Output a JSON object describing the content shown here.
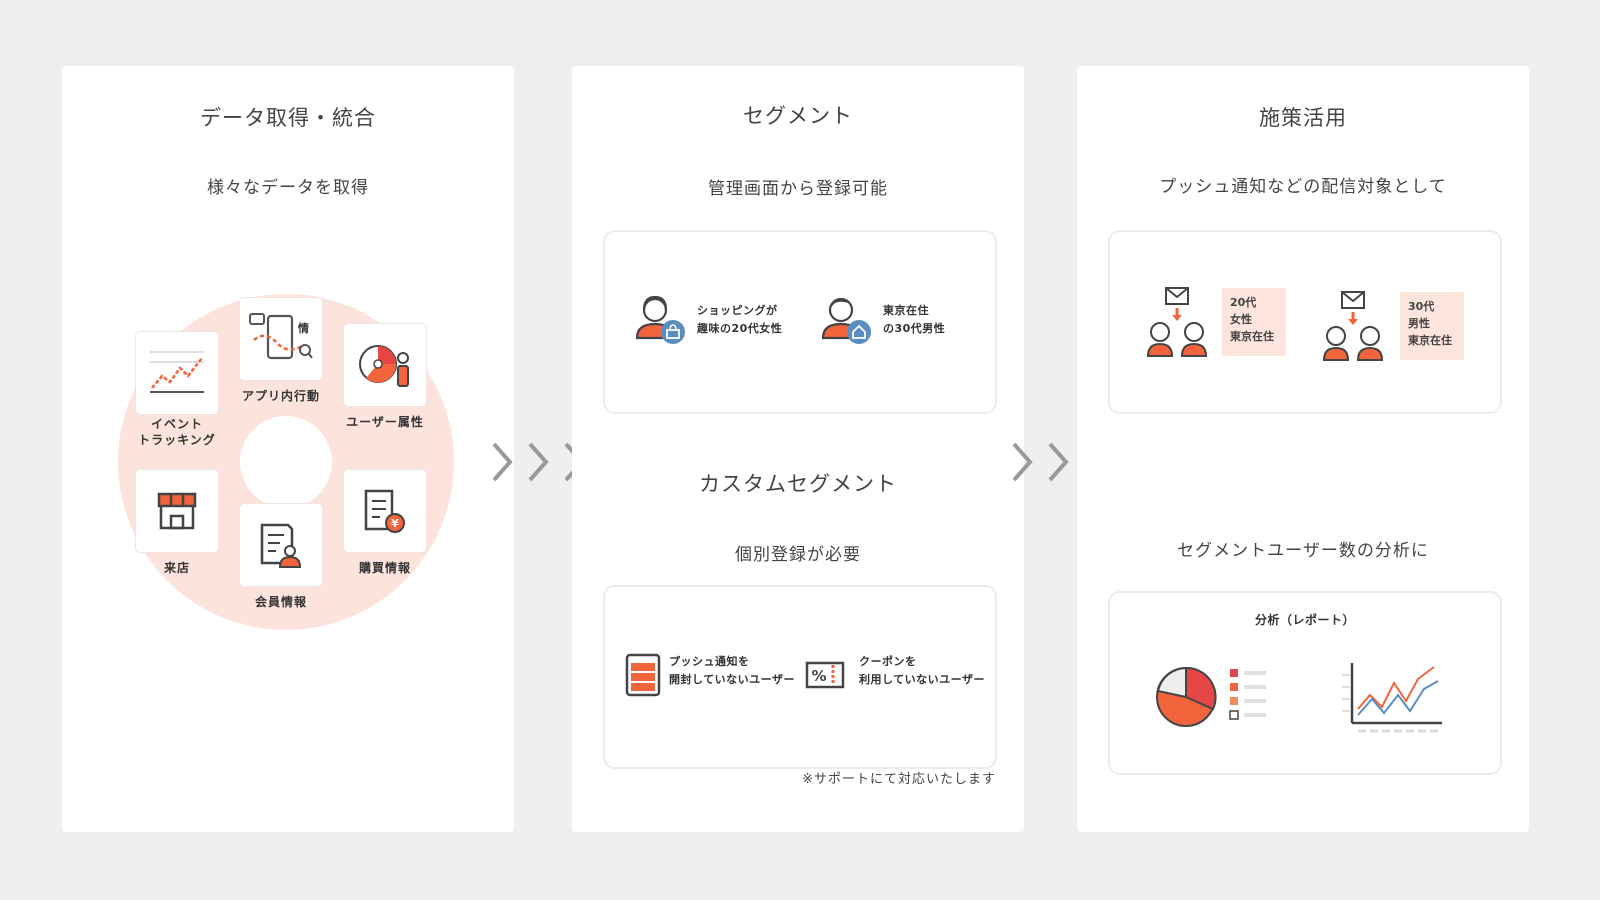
{
  "panels": {
    "acquire": {
      "title": "データ取得・統合",
      "subtitle": "様々なデータを取得",
      "sources": {
        "event": "イベント\nトラッキング",
        "app": "アプリ内行動",
        "attr": "ユーザー属性",
        "store": "来店",
        "member": "会員情報",
        "purchase": "購買情報"
      },
      "app_icon_glyph": "情"
    },
    "segment": {
      "title": "セグメント",
      "subtitle": "管理画面から登録可能",
      "examples": [
        {
          "label": "ショッピングが\n趣味の20代女性",
          "icon": "shopping-bag-icon"
        },
        {
          "label": "東京在住\nの30代男性",
          "icon": "home-icon"
        }
      ],
      "custom_title": "カスタムセグメント",
      "custom_subtitle": "個別登録が必要",
      "custom_examples": [
        {
          "label": "プッシュ通知を\n開封していないユーザー",
          "icon": "phone-list-icon"
        },
        {
          "label": "クーポンを\n利用していないユーザー",
          "icon": "coupon-icon"
        }
      ],
      "custom_coupon_glyph": "%",
      "note": "※サポートにて対応いたします"
    },
    "usage": {
      "title": "施策活用",
      "subtitle": "プッシュ通知などの配信対象として",
      "targets": [
        {
          "tag": "20代\n女性\n東京在住"
        },
        {
          "tag": "30代\n男性\n東京在住"
        }
      ],
      "analysis_subtitle": "セグメントユーザー数の分析に",
      "analysis_title": "分析（レポート）"
    }
  },
  "colors": {
    "accent": "#f2643c",
    "accent_light": "#fce4dc",
    "icon_blue": "#5a8ec0",
    "red": "#e54646",
    "arrow_gray": "#999999"
  }
}
